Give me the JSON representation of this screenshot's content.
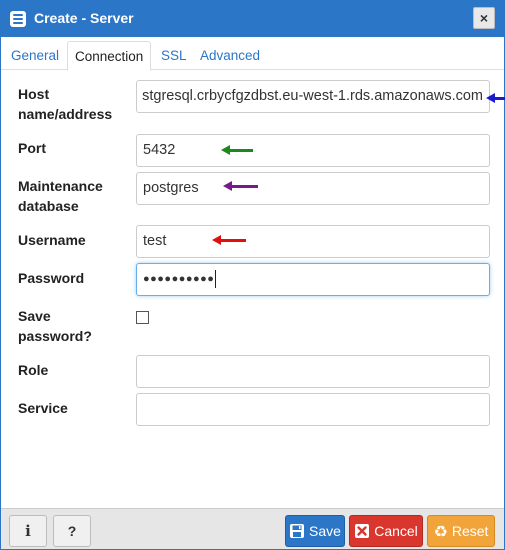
{
  "dialog": {
    "title": "Create - Server",
    "close_label": "×"
  },
  "tabs": [
    {
      "label": "General"
    },
    {
      "label": "Connection"
    },
    {
      "label": "SSL"
    },
    {
      "label": "Advanced"
    }
  ],
  "form": {
    "host_label_1": "Host",
    "host_label_2": "name/address",
    "host_value": "stgresql.crbycfgzdbst.eu-west-1.rds.amazonaws.com",
    "port_label": "Port",
    "port_value": "5432",
    "maintdb_label_1": "Maintenance",
    "maintdb_label_2": "database",
    "maintdb_value": "postgres",
    "username_label": "Username",
    "username_value": "test",
    "password_label": "Password",
    "password_value": "●●●●●●●●●●",
    "savepw_label_1": "Save",
    "savepw_label_2": "password?",
    "savepw_checked": false,
    "role_label": "Role",
    "role_value": "",
    "service_label": "Service",
    "service_value": ""
  },
  "annotations": {
    "host_arrow_color": "#1c1ccc",
    "port_arrow_color": "#1a8a1a",
    "maintdb_arrow_color": "#7a1a8a",
    "username_arrow_color": "#e01010"
  },
  "footer": {
    "info_label": "i",
    "help_label": "?",
    "save_label": "Save",
    "cancel_label": "Cancel",
    "reset_label": "Reset"
  }
}
